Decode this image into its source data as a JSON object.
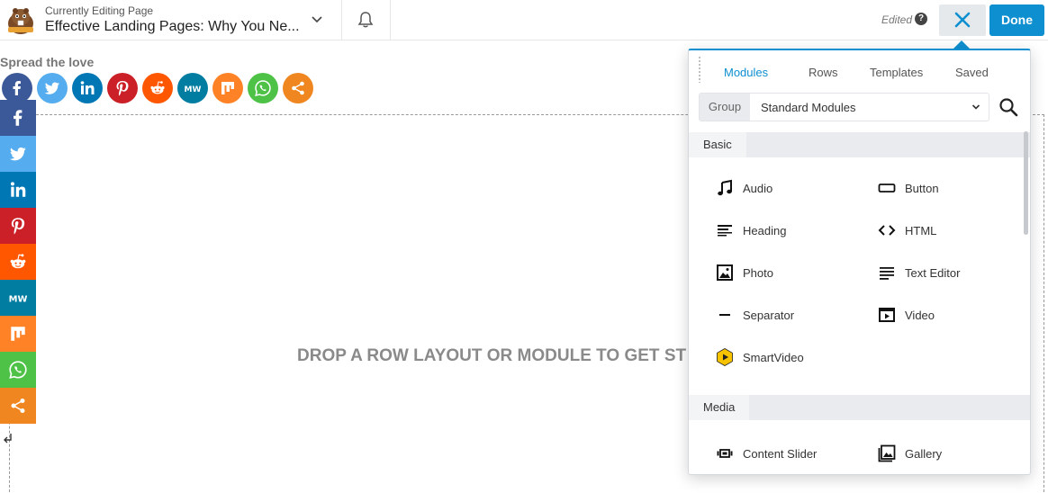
{
  "topbar": {
    "page_label": "Currently Editing Page",
    "page_title": "Effective Landing Pages: Why You Ne...",
    "edited": "Edited",
    "done_label": "Done"
  },
  "content": {
    "spread_label": "Spread the love",
    "drop_text": "DROP A ROW LAYOUT OR MODULE TO GET ST"
  },
  "share_buttons": [
    {
      "icon": "facebook-icon",
      "color": "#3b5998"
    },
    {
      "icon": "twitter-icon",
      "color": "#55acee"
    },
    {
      "icon": "linkedin-icon",
      "color": "#0077b5"
    },
    {
      "icon": "pinterest-icon",
      "color": "#cb2027"
    },
    {
      "icon": "reddit-icon",
      "color": "#ff5700"
    },
    {
      "icon": "mewe-icon",
      "color": "#007da1"
    },
    {
      "icon": "mix-icon",
      "color": "#ff8226"
    },
    {
      "icon": "whatsapp-icon",
      "color": "#4dc247"
    },
    {
      "icon": "share-icon",
      "color": "#f0861f"
    }
  ],
  "panel": {
    "tabs": [
      "Modules",
      "Rows",
      "Templates",
      "Saved"
    ],
    "active_tab": "Modules",
    "group_label": "Group",
    "group_value": "Standard Modules",
    "sections": [
      {
        "name": "Basic",
        "modules": [
          {
            "label": "Audio",
            "icon": "music-note-icon"
          },
          {
            "label": "Button",
            "icon": "button-icon"
          },
          {
            "label": "Heading",
            "icon": "heading-icon"
          },
          {
            "label": "HTML",
            "icon": "code-icon"
          },
          {
            "label": "Photo",
            "icon": "photo-icon"
          },
          {
            "label": "Text Editor",
            "icon": "text-editor-icon"
          },
          {
            "label": "Separator",
            "icon": "separator-icon"
          },
          {
            "label": "Video",
            "icon": "video-icon"
          },
          {
            "label": "SmartVideo",
            "icon": "smartvideo-icon"
          }
        ]
      },
      {
        "name": "Media",
        "modules": [
          {
            "label": "Content Slider",
            "icon": "content-slider-icon"
          },
          {
            "label": "Gallery",
            "icon": "gallery-icon"
          }
        ]
      }
    ]
  }
}
